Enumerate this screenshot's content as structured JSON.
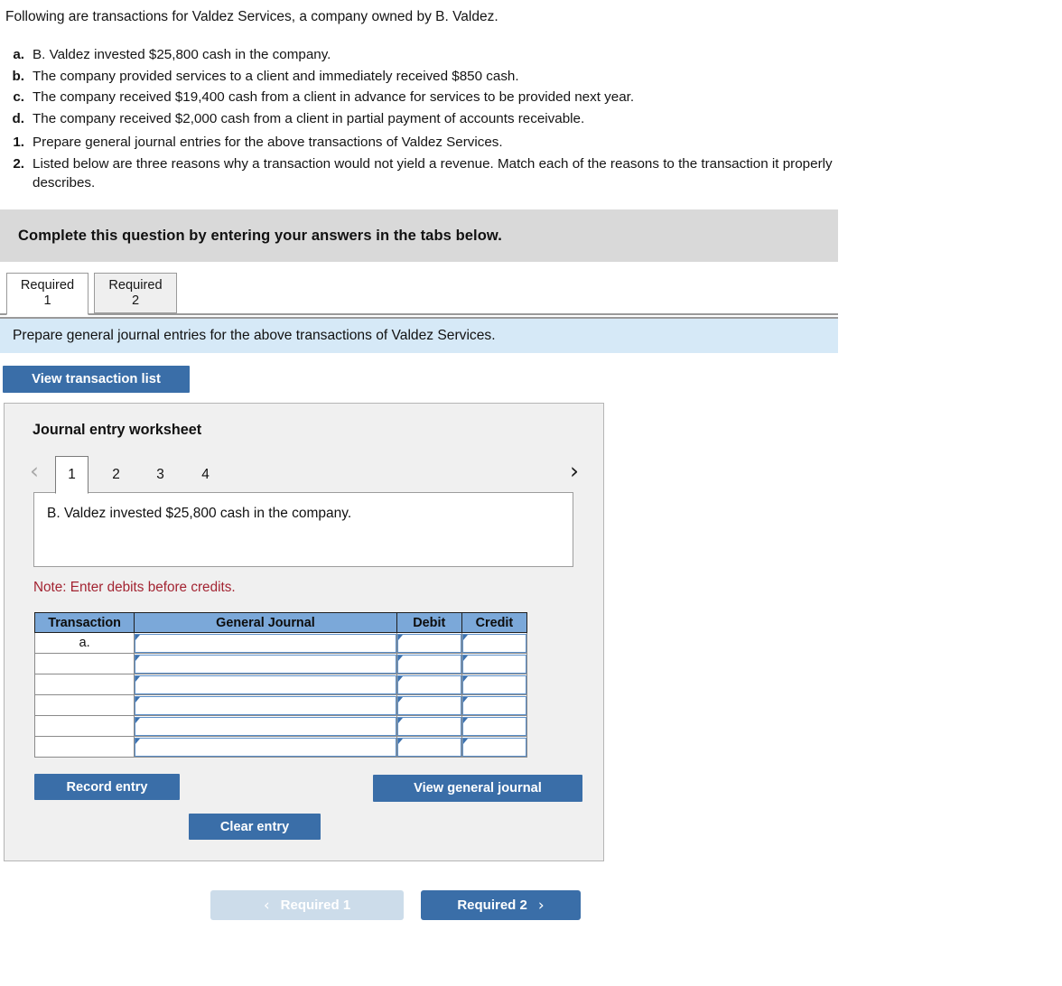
{
  "intro": "Following are transactions for Valdez Services, a company owned by B. Valdez.",
  "transactions": [
    {
      "marker": "a.",
      "text": "B. Valdez invested $25,800 cash in the company."
    },
    {
      "marker": "b.",
      "text": "The company provided services to a client and immediately received $850 cash."
    },
    {
      "marker": "c.",
      "text": "The company received $19,400 cash from a client in advance for services to be provided next year."
    },
    {
      "marker": "d.",
      "text": "The company received $2,000 cash from a client in partial payment of accounts receivable."
    }
  ],
  "requirements": [
    {
      "marker": "1.",
      "text": "Prepare general journal entries for the above transactions of Valdez Services."
    },
    {
      "marker": "2.",
      "text": "Listed below are three reasons why a transaction would not yield a revenue. Match each of the reasons to the transaction it properly describes."
    }
  ],
  "complete_banner": "Complete this question by entering your answers in the tabs below.",
  "tabs": [
    {
      "label": "Required 1",
      "line1": "Required",
      "line2": "1",
      "active": true
    },
    {
      "label": "Required 2",
      "line1": "Required",
      "line2": "2",
      "active": false
    }
  ],
  "requirement_bar": "Prepare general journal entries for the above transactions of Valdez Services.",
  "view_transaction_list_label": "View transaction list",
  "worksheet": {
    "title": "Journal entry worksheet",
    "prev_chevron": "‹",
    "next_chevron": "›",
    "pages": [
      "1",
      "2",
      "3",
      "4"
    ],
    "active_page": "1",
    "description": "B. Valdez invested $25,800 cash in the company.",
    "note": "Note: Enter debits before credits.",
    "table": {
      "headers": [
        "Transaction",
        "General Journal",
        "Debit",
        "Credit"
      ],
      "rows": [
        {
          "transaction": "a.",
          "general_journal": "",
          "debit": "",
          "credit": ""
        },
        {
          "transaction": "",
          "general_journal": "",
          "debit": "",
          "credit": ""
        },
        {
          "transaction": "",
          "general_journal": "",
          "debit": "",
          "credit": ""
        },
        {
          "transaction": "",
          "general_journal": "",
          "debit": "",
          "credit": ""
        },
        {
          "transaction": "",
          "general_journal": "",
          "debit": "",
          "credit": ""
        },
        {
          "transaction": "",
          "general_journal": "",
          "debit": "",
          "credit": ""
        }
      ]
    },
    "record_entry_label": "Record entry",
    "clear_entry_label": "Clear entry",
    "view_general_journal_label": "View general journal"
  },
  "bottom_nav": {
    "prev_label": "Required 1",
    "prev_chevron": "‹",
    "next_label": "Required 2",
    "next_chevron": "›"
  },
  "colors": {
    "primary_button": "#3a6ea8",
    "disabled_button": "#ccdcea",
    "banner_gray": "#d9d9d9",
    "requirement_blue": "#d6e9f7",
    "table_header_blue": "#7ba8d9",
    "note_red": "#a32432",
    "panel_gray": "#f0f0f0"
  }
}
